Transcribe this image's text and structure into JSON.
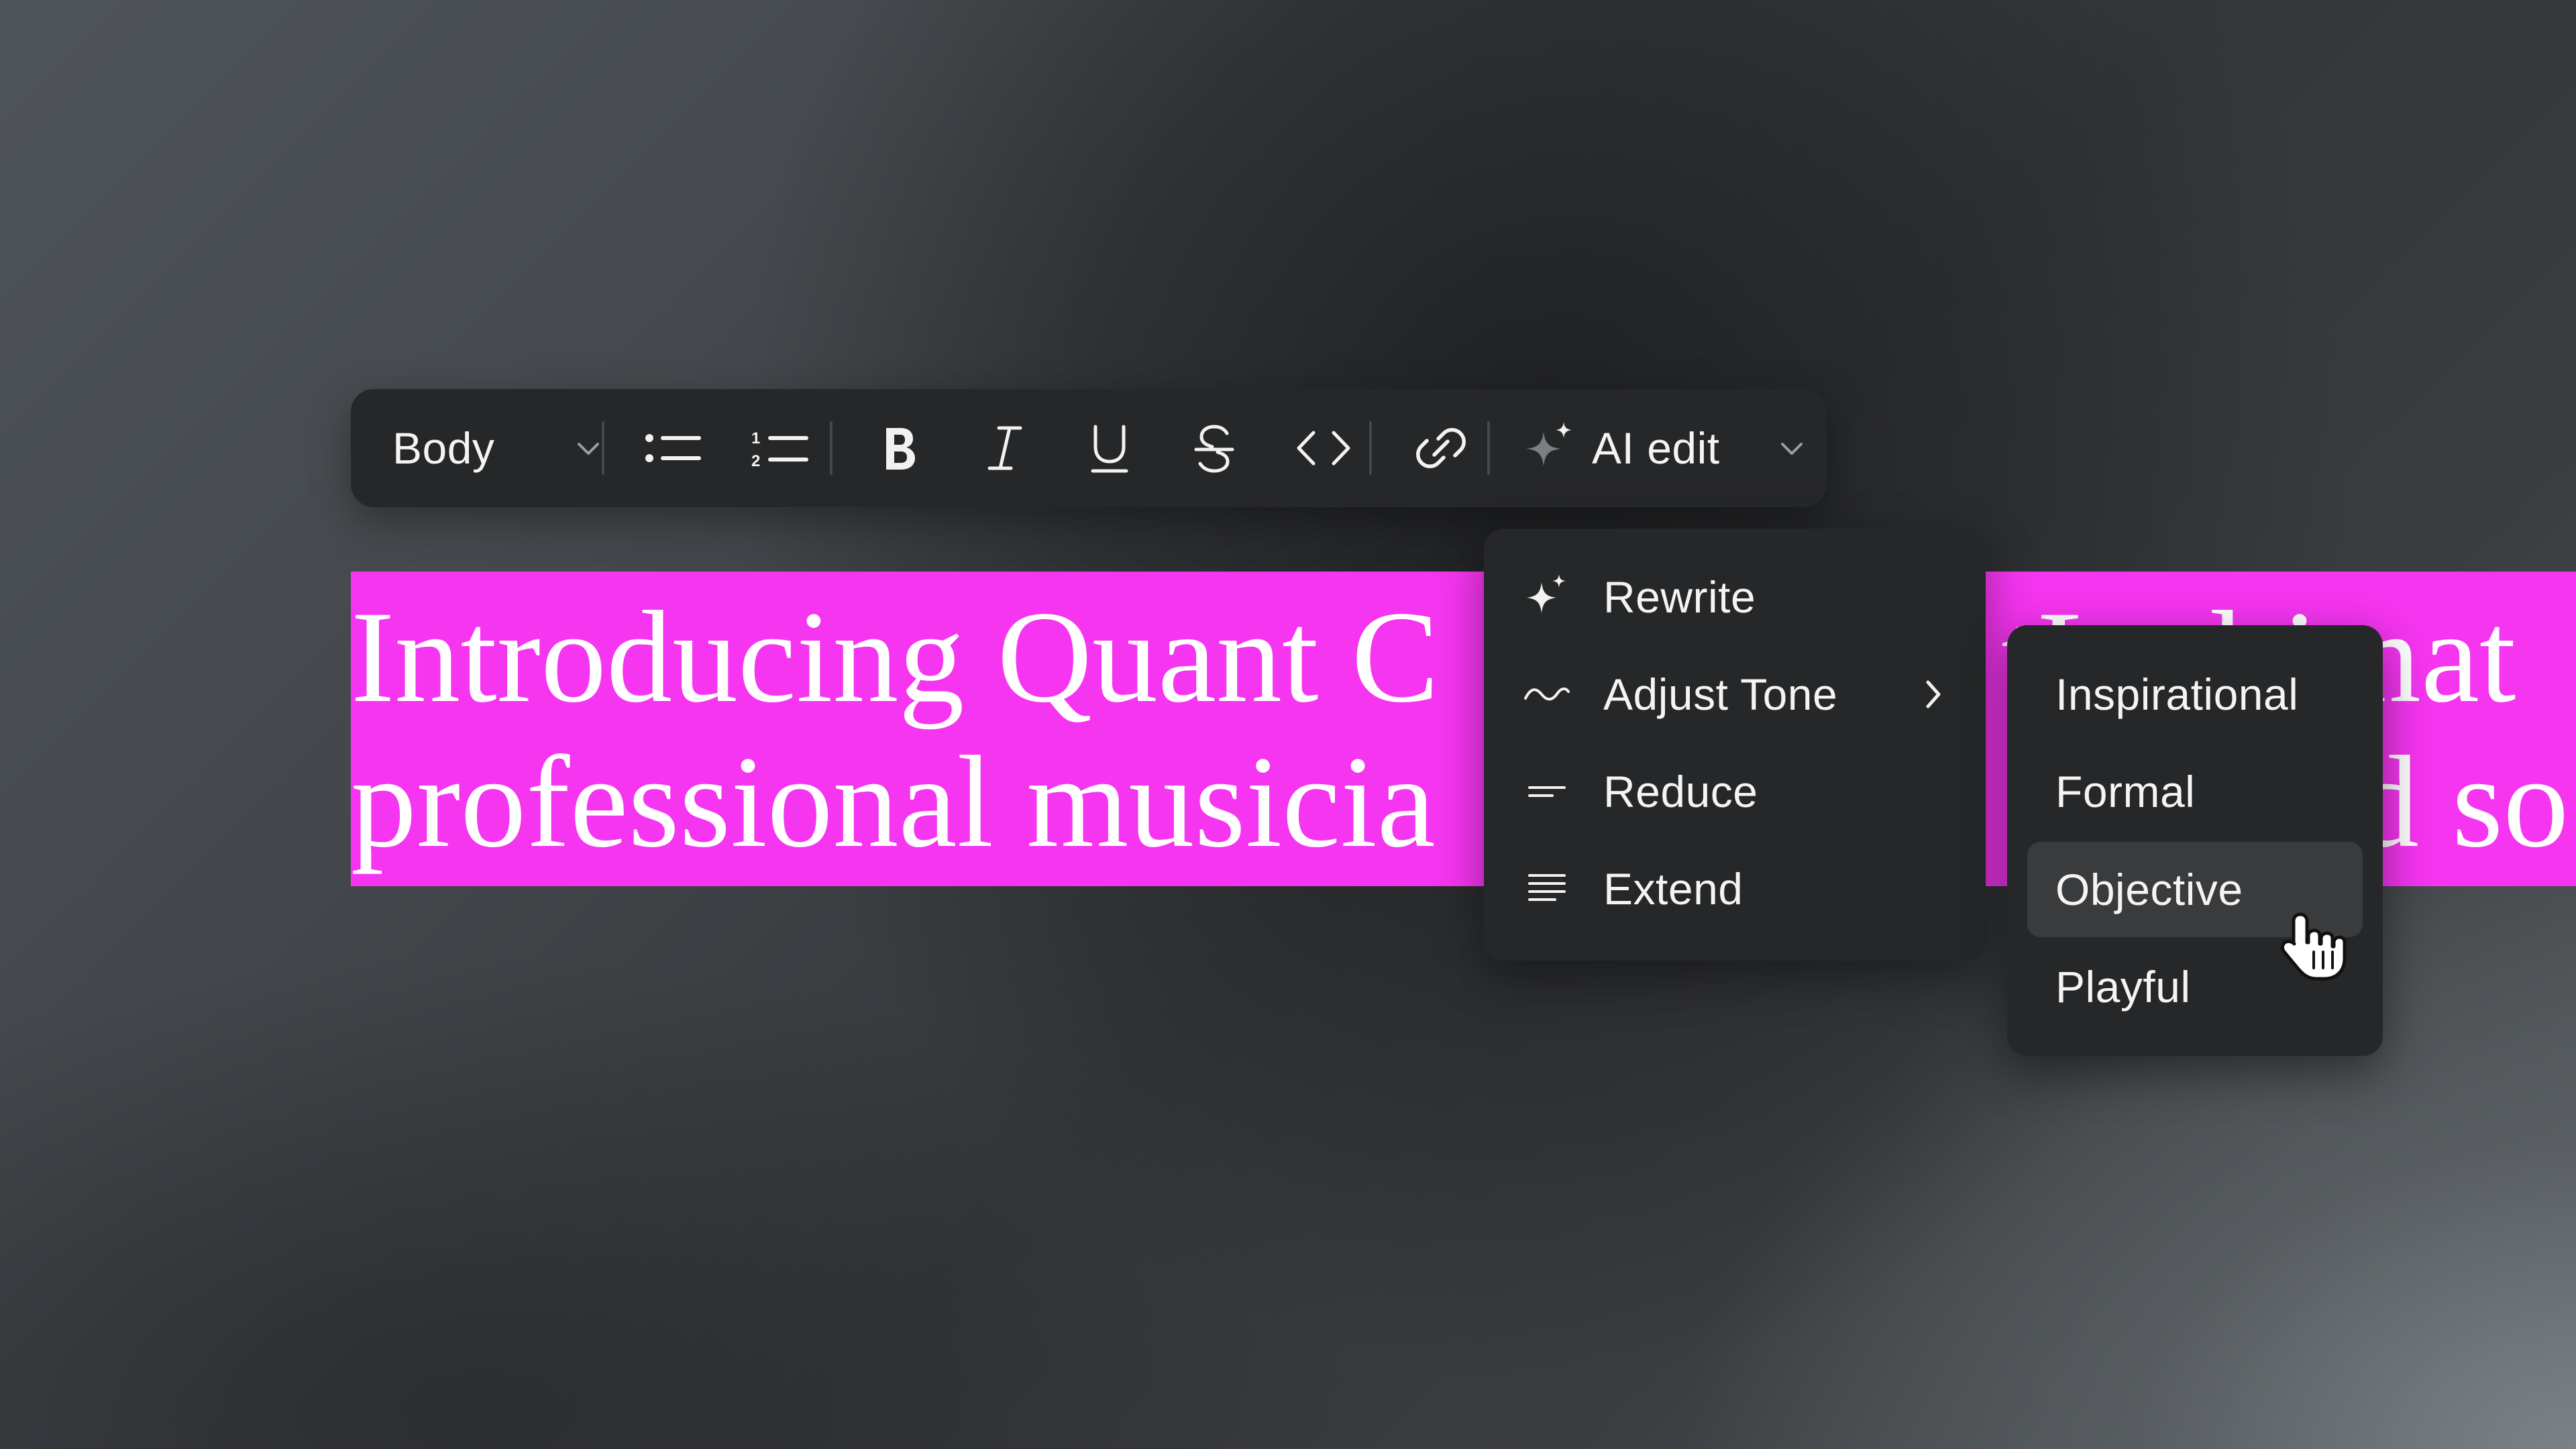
{
  "toolbar": {
    "text_style": {
      "label": "Body",
      "icon": "chevron-down-icon"
    },
    "buttons": [
      {
        "name": "bullet-list",
        "icon": "bullet-list-icon"
      },
      {
        "name": "numbered-list",
        "icon": "numbered-list-icon"
      },
      {
        "name": "bold",
        "icon": "bold-icon"
      },
      {
        "name": "italic",
        "icon": "italic-icon"
      },
      {
        "name": "underline",
        "icon": "underline-icon"
      },
      {
        "name": "strikethrough",
        "icon": "strikethrough-icon"
      },
      {
        "name": "code",
        "icon": "code-icon"
      },
      {
        "name": "link",
        "icon": "link-icon"
      }
    ],
    "ai_edit": {
      "label": "AI edit",
      "icon": "sparkle-icon"
    }
  },
  "document": {
    "heading_line1": "Introducing Quant C",
    "heading_line1_tail": "tLe  ltimat",
    "heading_line2": "professional musicia",
    "heading_line2_tail": "d so",
    "highlight_color": "#f535f0"
  },
  "ai_menu": {
    "items": [
      {
        "label": "Rewrite",
        "icon": "sparkle-icon"
      },
      {
        "label": "Adjust Tone",
        "icon": "wave-icon",
        "has_submenu": true
      },
      {
        "label": "Reduce",
        "icon": "reduce-lines-icon"
      },
      {
        "label": "Extend",
        "icon": "extend-lines-icon"
      }
    ]
  },
  "tone_menu": {
    "items": [
      {
        "label": "Inspirational"
      },
      {
        "label": "Formal"
      },
      {
        "label": "Objective",
        "selected": true
      },
      {
        "label": "Playful"
      }
    ]
  },
  "colors": {
    "toolbar_bg": "#262728",
    "menu_bg": "#262728",
    "selected_bg": "#3a3b3d",
    "text": "#f4f4f4"
  }
}
